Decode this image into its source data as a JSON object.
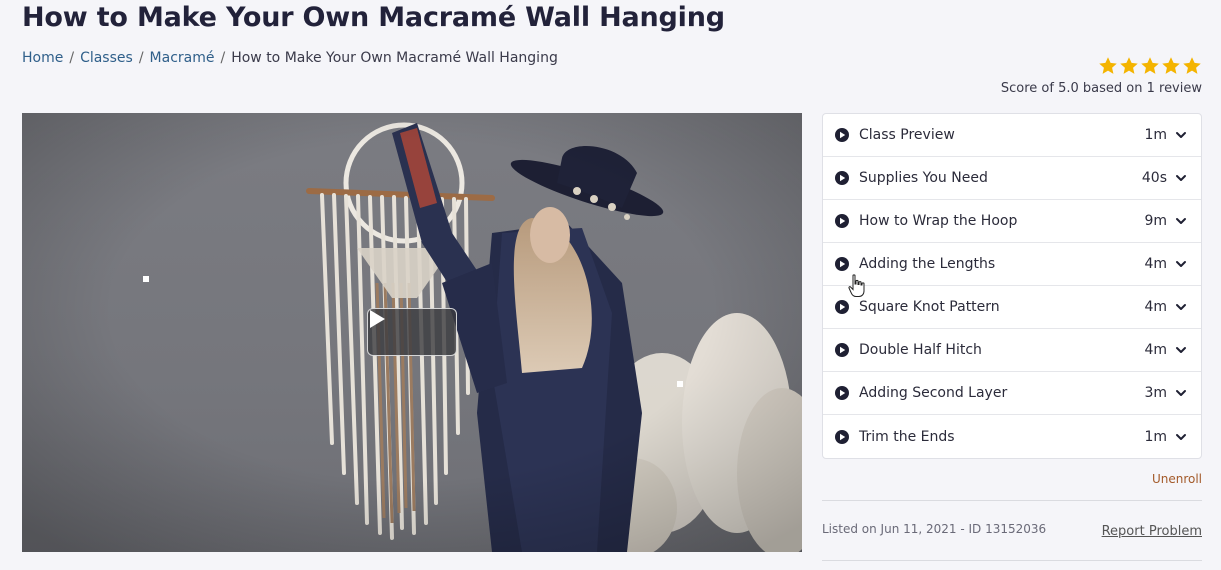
{
  "page": {
    "title": "How to Make Your Own Macramé Wall Hanging"
  },
  "breadcrumb": {
    "items": [
      "Home",
      "Classes",
      "Macramé"
    ],
    "current": "How to Make Your Own Macramé Wall Hanging",
    "separator": "/"
  },
  "rating": {
    "stars": 5,
    "text": "Score of 5.0 based on 1 review",
    "star_color": "#f4b400"
  },
  "lessons": [
    {
      "label": "Class Preview",
      "duration": "1m"
    },
    {
      "label": "Supplies You Need",
      "duration": "40s"
    },
    {
      "label": "How to Wrap the Hoop",
      "duration": "9m"
    },
    {
      "label": "Adding the Lengths",
      "duration": "4m"
    },
    {
      "label": "Square Knot Pattern",
      "duration": "4m"
    },
    {
      "label": "Double Half Hitch",
      "duration": "4m"
    },
    {
      "label": "Adding Second Layer",
      "duration": "3m"
    },
    {
      "label": "Trim the Ends",
      "duration": "1m"
    }
  ],
  "actions": {
    "unenroll": "Unenroll",
    "report": "Report Problem"
  },
  "meta": {
    "listed": "Listed on Jun 11, 2021 - ID 13152036"
  },
  "colors": {
    "link": "#2f5f8a",
    "unenroll": "#a35a2a",
    "background": "#f5f5f9"
  }
}
